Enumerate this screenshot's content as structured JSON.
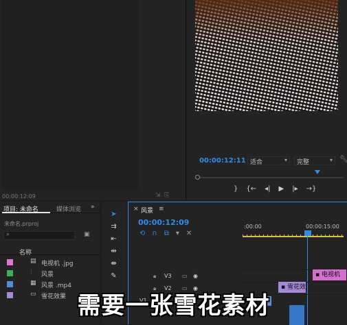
{
  "source": {
    "timecode": "00:00:12:09"
  },
  "program": {
    "timecode": "00:00:12:11",
    "fit_select": "适合",
    "quality_select": "完整"
  },
  "project_panel": {
    "tab_project": "项目: 未命名",
    "tab_media": "媒体浏览",
    "file": "未命名.prproj",
    "column_name": "名称",
    "items": [
      {
        "label": "电视机 .jpg",
        "color": "#e86fd7",
        "icon": "image-icon"
      },
      {
        "label": "风景",
        "color": "#3fae5b",
        "icon": "sequence-icon"
      },
      {
        "label": "风景 .mp4",
        "color": "#4a8fdb",
        "icon": "video-icon"
      },
      {
        "label": "雪花效果",
        "color": "#a48ad6",
        "icon": "clip-icon"
      }
    ]
  },
  "timeline": {
    "sequence_name": "风景",
    "timecode": "00:00:12:09",
    "ruler_start": ":00:00",
    "ruler_mid": "00:00:15:00",
    "tracks": [
      "V3",
      "V2",
      "V1"
    ],
    "clips": {
      "tv": "电视机",
      "snow": "雪花效"
    }
  },
  "subtitle": "需要一张雪花素材",
  "colors": {
    "accent": "#2d8ceb",
    "tv_clip": "#d66fd1",
    "snow_clip": "#a48ad6"
  }
}
